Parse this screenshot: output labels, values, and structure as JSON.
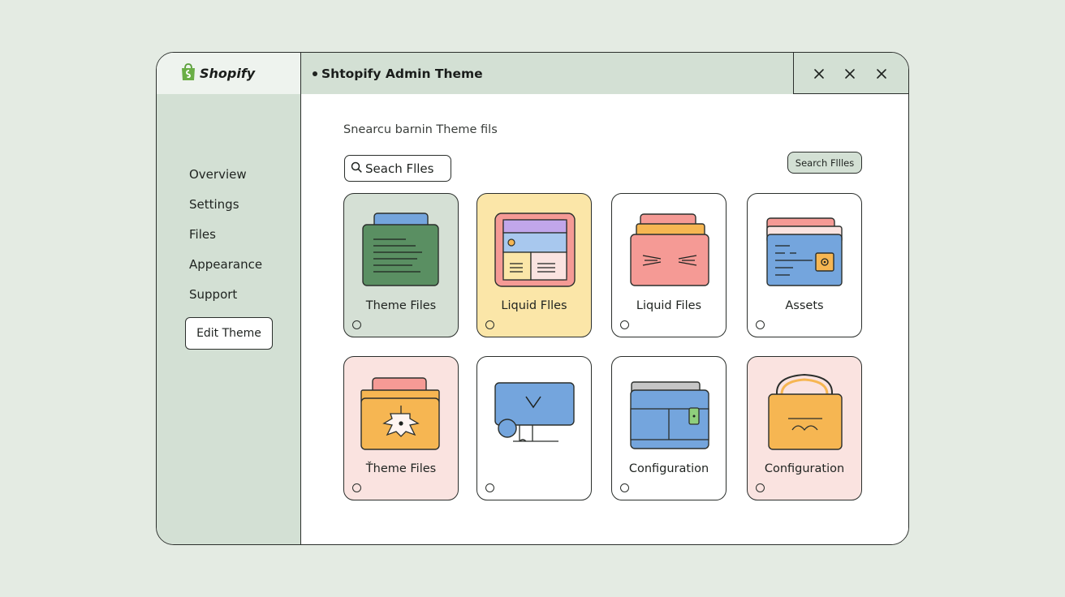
{
  "app": {
    "brand": "Shopify",
    "window_title": "Shtopify Admin Theme"
  },
  "sidebar": {
    "items": [
      {
        "label": "Overview"
      },
      {
        "label": "Settings"
      },
      {
        "label": "Files"
      },
      {
        "label": "Appearance"
      },
      {
        "label": "Support"
      }
    ],
    "edit_button": "Edit Theme"
  },
  "main": {
    "subtitle": "Snearcu barnin Theme fils",
    "search": {
      "value": "Seach Flles"
    },
    "search_button": "Search Fllles",
    "cards": [
      {
        "label": "Theme Files",
        "bg": "#d5e0d5",
        "icon": "folder-document-icon"
      },
      {
        "label": "Liquid Flles",
        "bg": "#fbe6a8",
        "icon": "layout-template-icon"
      },
      {
        "label": "Liquid Files",
        "bg": "#ffffff",
        "icon": "folder-code-icon"
      },
      {
        "label": "Assets",
        "bg": "#ffffff",
        "icon": "asset-folder-icon"
      },
      {
        "label": "Ťheme Files",
        "bg": "#fae3e0",
        "icon": "theme-folder-icon"
      },
      {
        "label": "",
        "bg": "#ffffff",
        "icon": "monitor-icon"
      },
      {
        "label": "Configuration",
        "bg": "#ffffff",
        "icon": "wallet-config-icon"
      },
      {
        "label": "Configuration",
        "bg": "#fae3e0",
        "icon": "shopping-bag-icon"
      }
    ]
  },
  "colors": {
    "sidebar_bg": "#d3e0d4",
    "border": "#2b2f2c",
    "green": "#5a8f62",
    "blue": "#74a5dd",
    "red": "#f59a95",
    "yellow": "#f6b652",
    "purple": "#c1a6ea"
  }
}
